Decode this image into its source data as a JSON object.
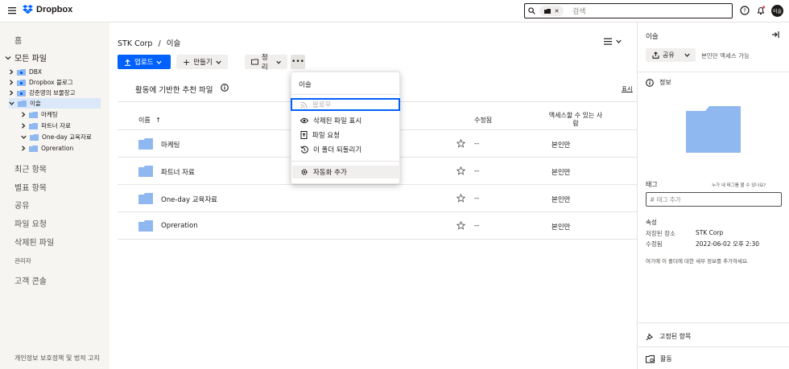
{
  "app": {
    "name": "Dropbox"
  },
  "colors": {
    "accent": "#0061fe",
    "folder": "#90b8f0",
    "sidebar_bg": "#f7f5f2",
    "selected": "#dbe8f9",
    "notification": "#e64c5c"
  },
  "search": {
    "placeholder": "검색"
  },
  "user": {
    "avatar_initials": "이슬"
  },
  "sidebar": {
    "home": "홈",
    "all_files": "모든 파일",
    "tree": [
      {
        "label": "DBX",
        "level": 0,
        "expanded": false
      },
      {
        "label": "Dropbox 블로그",
        "level": 0,
        "expanded": false
      },
      {
        "label": "강준영의 보물창고",
        "level": 0,
        "expanded": false
      },
      {
        "label": "이슬",
        "level": 0,
        "expanded": true,
        "selected": true
      },
      {
        "label": "마케팅",
        "level": 1,
        "expanded": false
      },
      {
        "label": "파트너 자료",
        "level": 1,
        "expanded": false
      },
      {
        "label": "One-day 교육자료",
        "level": 1,
        "expanded": true
      },
      {
        "label": "Opreration",
        "level": 1,
        "expanded": false
      }
    ],
    "items": [
      "최근 항목",
      "별표 항목",
      "공유",
      "파일 요청",
      "삭제된 파일"
    ],
    "admin": "관리자",
    "console": "고객 콘솔",
    "footer": "개인정보 보호정책 및 법적 고지"
  },
  "main": {
    "breadcrumb_root": "STK Corp",
    "breadcrumb_sep": "/",
    "breadcrumb_current": "이슬",
    "toolbar": {
      "upload": "업로드",
      "create": "만들기",
      "organize": "정리"
    },
    "recommended_title": "활동에 기반한 추천 파일",
    "show_label": "표시",
    "columns": {
      "name": "이름",
      "modified": "수정됨",
      "access": "액세스할 수 있는 사람"
    },
    "files": [
      {
        "name": "마케팅",
        "modified": "--",
        "access": "본인만"
      },
      {
        "name": "파트너 자료",
        "modified": "--",
        "access": "본인만"
      },
      {
        "name": "One-day 교육자료",
        "modified": "--",
        "access": "본인만"
      },
      {
        "name": "Opreration",
        "modified": "--",
        "access": "본인만"
      }
    ]
  },
  "dropdown": {
    "title": "이슬",
    "items": [
      "팔로우",
      "삭제된 파일 표시",
      "파일 요청",
      "이 폴더 되돌리기"
    ],
    "automation": "자동화 추가"
  },
  "panel": {
    "title": "이슬",
    "share": "공유",
    "share_note": "본인만 액세스 가능",
    "info": "정보",
    "tags_label": "태그",
    "tags_hint": "누가 내 태그를 볼 수 있나요?",
    "tags_placeholder": "# 태그 추가",
    "properties_title": "속성",
    "saved_location_label": "저장된 장소",
    "saved_location_value": "STK Corp",
    "modified_label": "수정됨",
    "modified_value": "2022-06-02 오후 2:30",
    "description": "여기에 이 폴더에 대한 세부 정보를 추가하세요.",
    "pinned": "고정된 항목",
    "activity": "활동"
  }
}
